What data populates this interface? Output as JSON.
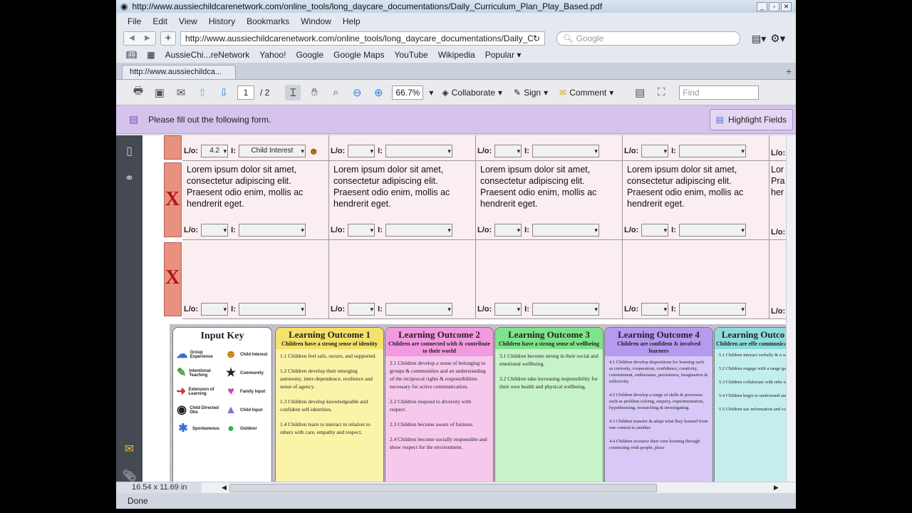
{
  "window": {
    "title": "http://www.aussiechildcarenetwork.com/online_tools/long_daycare_documentations/Daily_Curriculum_Plan_Play_Based.pdf"
  },
  "menu": [
    "File",
    "Edit",
    "View",
    "History",
    "Bookmarks",
    "Window",
    "Help"
  ],
  "nav": {
    "url": "http://www.aussiechildcarenetwork.com/online_tools/long_daycare_documentations/Daily_Curri",
    "search_placeholder": "Google"
  },
  "bookmarks": [
    "AussieChi...reNetwork",
    "Yahoo!",
    "Google",
    "Google Maps",
    "YouTube",
    "Wikipedia",
    "Popular ▾"
  ],
  "tab": {
    "label": "http://www.aussiechildca..."
  },
  "toolbar": {
    "page": "1",
    "page_total": "/ 2",
    "zoom": "66.7%",
    "collaborate": "Collaborate",
    "sign": "Sign",
    "comment": "Comment",
    "find_placeholder": "Find"
  },
  "formbar": {
    "message": "Please fill out the following form.",
    "highlight": "Highlight Fields"
  },
  "doc": {
    "lo_label": "L/o:",
    "i_label": "I:",
    "row0_lo": "4.2",
    "row0_i": "Child Interest",
    "lorem": [
      "Lorem ipsum dolor sit amet,",
      "consectetur adipiscing elit.",
      "Praesent odio enim, mollis ac",
      "hendrerit eget."
    ],
    "lorem_cut": [
      "Lor",
      "Pra",
      "her"
    ],
    "x": "X",
    "input_key_title": "Input  Key",
    "input_key": [
      "Group Experience",
      "Child Interest",
      "Intentional Teaching",
      "Community",
      "Extension of Learning",
      "Family Input",
      "Child Directed Obs",
      "Child Input",
      "Spontaneous",
      "Outdoor"
    ],
    "outcomes": [
      {
        "title": "Learning Outcome 1",
        "sub": "Children have a strong sense of identity",
        "color": "#f5e26a",
        "body_color": "#faf3a8",
        "items": [
          "1.1 Children feel safe, secure, and supported.",
          "1.2 Children develop their emerging autonomy, inter-dependence, resilience and sense of agency.",
          "1.3 Children develop knowledgeable and confident self-identities.",
          "1.4 Children learn to interact in relation to others with care, empathy and respect."
        ]
      },
      {
        "title": "Learning Outcome 2",
        "sub": "Children are connected with & contribute to their world",
        "color": "#f29ae0",
        "body_color": "#f7c8ee",
        "items": [
          "2.1 Children develop a sense of belonging to groups & communities and an understanding of the reciprocal rights & responsibilities necessary for active communication.",
          "2.2 Children respond to diversity with respect.",
          "2.3 Children become aware of fairness.",
          "2.4 Children become socially responsible and show respect for the environment."
        ]
      },
      {
        "title": "Learning Outcome 3",
        "sub": "Children have a strong sense of wellbeing",
        "color": "#7fe38b",
        "body_color": "#c7f3c8",
        "items": [
          "3.1 Children become strong in their social and emotional wellbeing.",
          "3.2 Children take increasing responsibility for their own health and physical wellbeing."
        ]
      },
      {
        "title": "Learning Outcome 4",
        "sub": "Children are confident & involved learners",
        "color": "#b59af0",
        "body_color": "#d7c8f7",
        "items": [
          "4.1 Children develop dispositions for learning such as curiosity, cooperation, confidence, creativity, commitment, enthusiasm, persistence, imagination & reflexivity.",
          "4.2 Children develop a range of skills & processes such as problem solving, enquiry, experimentation, hypothesising, researching & investigating.",
          "4.3 Children transfer & adapt what they learned from one context to another.",
          "4.4 Children resource their own learning through connecting with people, place"
        ]
      },
      {
        "title": "Learning Outco",
        "sub": "Children are effe communicator",
        "color": "#8fdcdc",
        "body_color": "#c4eeee",
        "items": [
          "5.1 Children interact verbally & n with others for a range of purpo",
          "5.2 Children engage with a range gain meaning from these texts.",
          "5.3 Children collaborate with othe ideas and make meaning using a media and communication technol",
          "5.4 Children begin to understand and pattern systems work.",
          "5.5 Children use information and communication technologies to a"
        ]
      }
    ]
  },
  "scroll": {
    "dims": "16.54 x 11.69 in"
  },
  "status": {
    "text": "Done"
  }
}
